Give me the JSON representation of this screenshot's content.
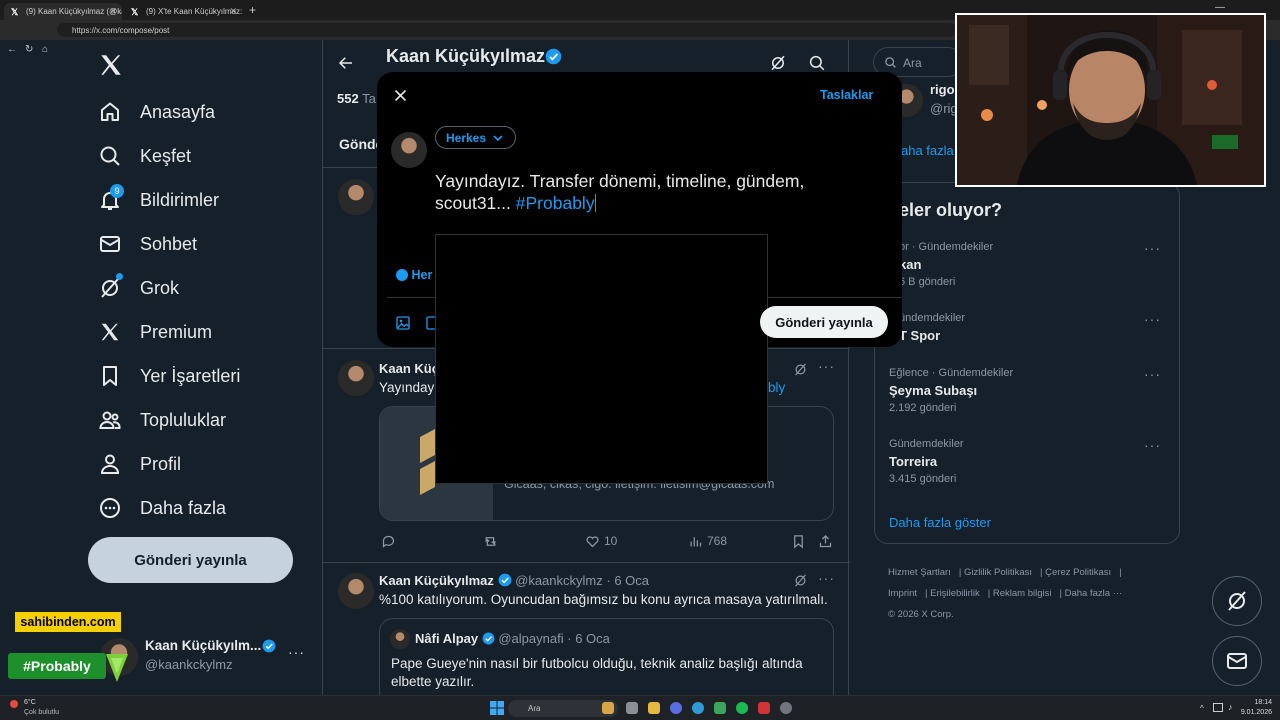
{
  "browser": {
    "tabs": [
      {
        "title": "(9) Kaan Küçükyılmaz (@kaankckylmaz) / X"
      },
      {
        "title": "(9) X'te Kaan Küçükyılmaz: \"Hastalık...\""
      }
    ],
    "url": "https://x.com/compose/post"
  },
  "sidebar": {
    "items": [
      {
        "label": "Anasayfa",
        "icon": "home-icon"
      },
      {
        "label": "Keşfet",
        "icon": "search-icon"
      },
      {
        "label": "Bildirimler",
        "icon": "bell-icon",
        "badge": "9"
      },
      {
        "label": "Sohbet",
        "icon": "mail-icon"
      },
      {
        "label": "Grok",
        "icon": "grok-icon"
      },
      {
        "label": "Premium",
        "icon": "x-logo-icon"
      },
      {
        "label": "Yer İşaretleri",
        "icon": "bookmark-icon"
      },
      {
        "label": "Topluluklar",
        "icon": "people-icon"
      },
      {
        "label": "Profil",
        "icon": "person-icon"
      },
      {
        "label": "Daha fazla",
        "icon": "more-circle-icon"
      }
    ],
    "post_button": "Gönderi yayınla",
    "account": {
      "name": "Kaan Küçükyılm...",
      "handle": "@kaankckylmz"
    }
  },
  "profile_header": {
    "name": "Kaan Küçükyılmaz",
    "count_number": "552",
    "count_label": "Ta",
    "tab_partial": "Gönde"
  },
  "tweets": [
    {
      "name": "Kaan Küç",
      "text_partial": "Yayındayı",
      "link_partial": "bly",
      "card_text": "Gicaas, cikas, cigo. iletişim: iletisim@gicaas.com",
      "actions": {
        "reply": "",
        "retweet": "",
        "like": "10",
        "views": "768"
      }
    },
    {
      "name": "Kaan Küçükyılmaz",
      "handle": "@kaankckylmz",
      "date": "6 Oca",
      "text": "%100 katılıyorum. Oyuncudan bağımsız bu konu ayrıca masaya yatırılmalı.",
      "quote": {
        "name": "Nâfi Alpay",
        "handle": "@alpaynafi",
        "date": "6 Oca",
        "text": "Pape Gueye'nin nasıl bir futbolcu olduğu, teknik analiz başlığı altında elbette yazılır."
      }
    }
  ],
  "composer": {
    "drafts": "Taslaklar",
    "audience": "Herkes",
    "text_plain": "Yayındayız. Transfer dönemi, timeline, gündem, scout31...",
    "hashtag": "#Probably",
    "reply_setting_partial": "Her",
    "submit": "Gönderi yayınla"
  },
  "right": {
    "search_placeholder": "Ara",
    "who_partial_name": "rigo",
    "who_partial_handle": "@rig",
    "show_more_partial": "aha fazla",
    "trends_title": "eler oluyor?",
    "trends": [
      {
        "category": "or · Gündemdekiler",
        "name": "kan",
        "count": "6 B gönderi"
      },
      {
        "category": "ündemdekiler",
        "name": "T Spor",
        "count": ""
      },
      {
        "category": "Eğlence · Gündemdekiler",
        "name": "Şeyma Subaşı",
        "count": "2.192 gönderi"
      },
      {
        "category": "Gündemdekiler",
        "name": "Torreira",
        "count": "3.415 gönderi"
      }
    ],
    "trends_more": "Daha fazla göster",
    "footer": [
      "Hizmet Şartları",
      "Gizlilik Politikası",
      "Çerez Politikası",
      "Imprint",
      "Erişilebilirlik",
      "Reklam bilgisi",
      "Daha fazla ···",
      "© 2026 X Corp."
    ]
  },
  "overlays": {
    "sponsor": "sahibinden.com",
    "tag": "#Probably"
  },
  "taskbar": {
    "weather_temp": "6°C",
    "weather_desc": "Çok bulutlu",
    "search": "Ara",
    "time": "18:14",
    "date": "9.01.2026"
  },
  "colors": {
    "accent": "#1d9bf0",
    "background": "#15202b",
    "modal": "#000000"
  }
}
